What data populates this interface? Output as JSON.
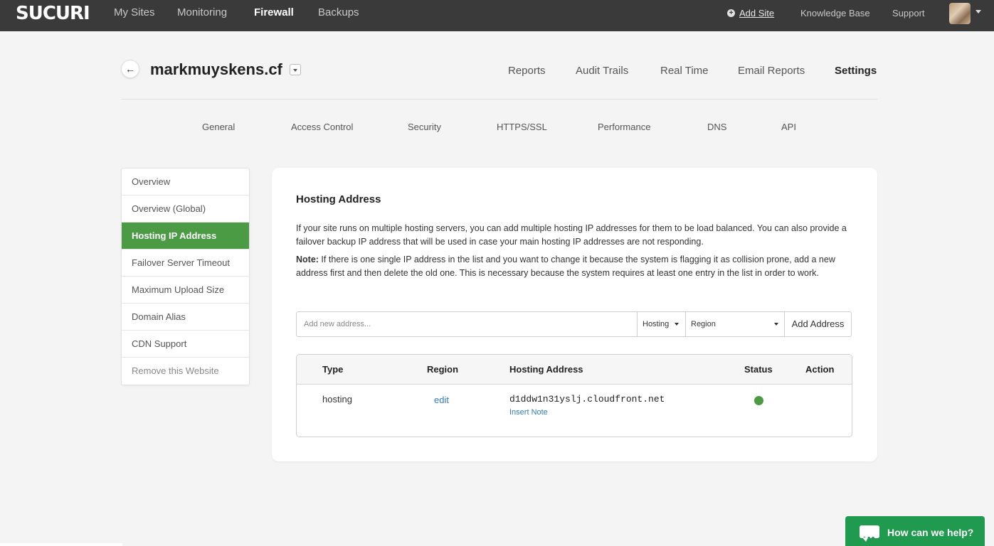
{
  "topbar": {
    "logo": "SUCURI",
    "nav": [
      "My Sites",
      "Monitoring",
      "Firewall",
      "Backups"
    ],
    "active_nav": "Firewall",
    "add_site": "Add Site",
    "knowledge_base": "Knowledge Base",
    "support": "Support"
  },
  "site": {
    "name": "markmuyskens.cf",
    "tabs": [
      "Reports",
      "Audit Trails",
      "Real Time",
      "Email Reports",
      "Settings"
    ],
    "active_tab": "Settings"
  },
  "subtabs": [
    "General",
    "Access Control",
    "Security",
    "HTTPS/SSL",
    "Performance",
    "DNS",
    "API"
  ],
  "sidemenu": {
    "items": [
      "Overview",
      "Overview (Global)",
      "Hosting IP Address",
      "Failover Server Timeout",
      "Maximum Upload Size",
      "Domain Alias",
      "CDN Support",
      "Remove this Website"
    ],
    "active": "Hosting IP Address"
  },
  "main": {
    "title": "Hosting Address",
    "intro": "If your site runs on multiple hosting servers, you can add multiple hosting IP addresses for them to be load balanced. You can also provide a failover backup IP address that will be used in case your main hosting IP addresses are not responding.",
    "note_label": "Note:",
    "note_text": " If there is one single IP address in the list and you want to change it because the system is flagging it as collision prone, add a new address first and then delete the old one. This is necessary because the system requires at least one entry in the list in order to work.",
    "input_placeholder": "Add new address...",
    "type_select": "Hosting",
    "region_select": "Region",
    "add_button": "Add Address",
    "table": {
      "headers": [
        "Type",
        "Region",
        "Hosting Address",
        "Status",
        "Action"
      ],
      "rows": [
        {
          "type": "hosting",
          "region": "edit",
          "address": "d1ddw1n31yslj.cloudfront.net",
          "note_link": "Insert Note",
          "status_color": "#4b9b45"
        }
      ]
    }
  },
  "help": {
    "label": "How can we help?"
  },
  "colors": {
    "accent": "#4b9b45",
    "link": "#2f7bbf",
    "topbar": "#3a3a3a",
    "help": "#1f9a4e"
  }
}
